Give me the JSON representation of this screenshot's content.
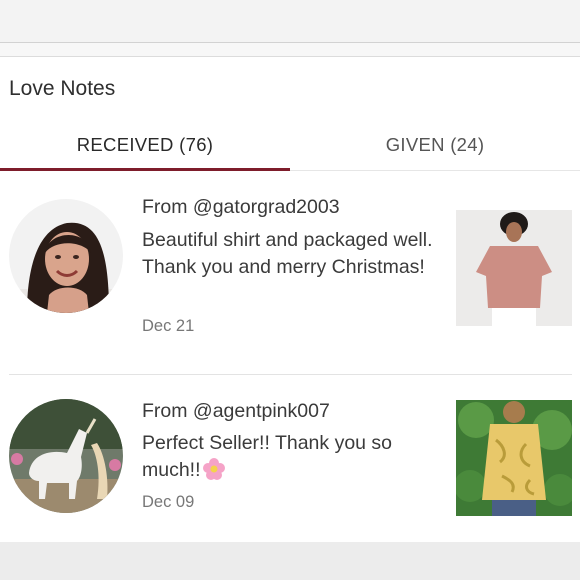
{
  "section": {
    "title": "Love Notes"
  },
  "tabs": {
    "received": "RECEIVED (76)",
    "given": "GIVEN (24)"
  },
  "notes": [
    {
      "from": "From @gatorgrad2003",
      "message": "Beautiful shirt and packaged well. Thank you and merry Christmas!",
      "date": "Dec 21"
    },
    {
      "from": "From @agentpink007",
      "message": "Perfect Seller!! Thank you so much!!",
      "emoji": "flower-emoji-icon",
      "date": "Dec 09"
    }
  ],
  "colors": {
    "accent": "#7e1d2b",
    "panel": "#ffffff",
    "background": "#ededed"
  }
}
